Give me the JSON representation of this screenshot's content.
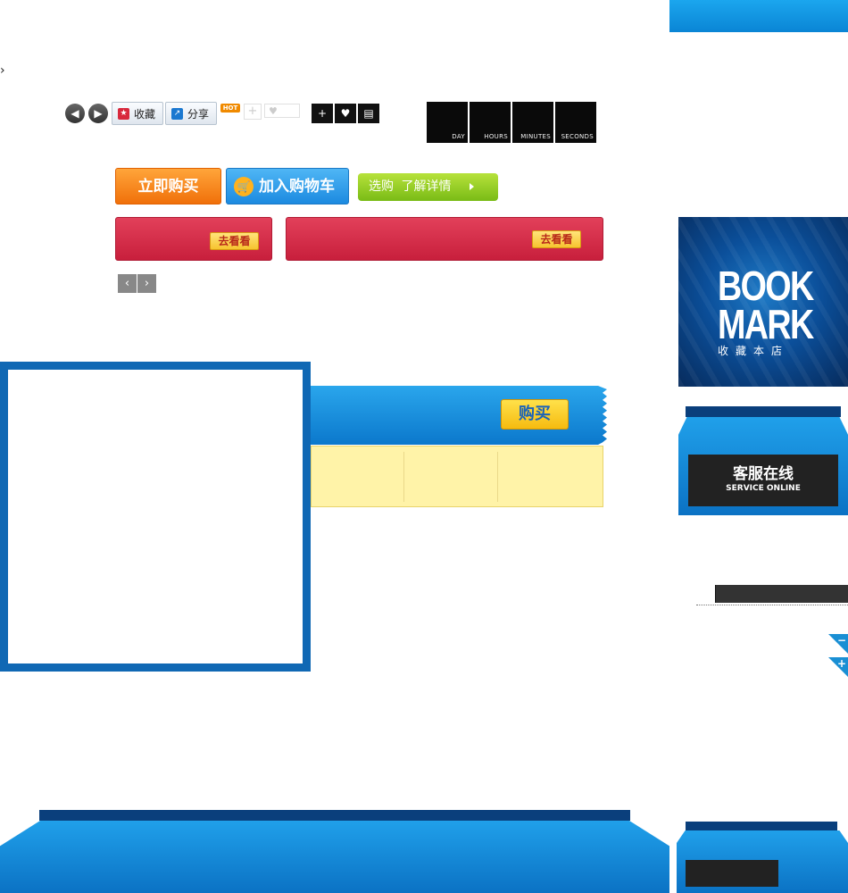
{
  "toolbar": {
    "favorite_label": "收藏",
    "share_label": "分享",
    "hot_badge": "HOT",
    "plus_symbol": "+",
    "heart_symbol": "♥",
    "comment_symbol": "▤"
  },
  "countdown": {
    "units": [
      "DAY",
      "HOURS",
      "MINUTES",
      "SECONDS"
    ]
  },
  "buttons": {
    "buy_now": "立即购买",
    "add_to_cart": "加入购物车",
    "select_buy": "选购",
    "learn_details": "了解详情",
    "go_look": "去看看"
  },
  "bookmark": {
    "line1": "BOOK",
    "line2": "MARK",
    "subtitle": "收藏本店"
  },
  "service": {
    "title_cn": "客服在线",
    "title_en": "SERVICE ONLINE"
  },
  "promo": {
    "buy_label": "购买"
  },
  "corner": {
    "minus": "−",
    "plus": "+"
  },
  "colors": {
    "accent_blue": "#0b78cc",
    "promo_red": "#c81f3c",
    "buy_orange": "#f0700a",
    "detail_green": "#79bb16",
    "highlight_yellow": "#fff3a8"
  },
  "icons": [
    "chevron-right-icon",
    "arrow-left-icon",
    "arrow-right-icon",
    "star-icon",
    "share-icon",
    "plus-icon",
    "heart-icon",
    "comment-icon",
    "cart-icon",
    "triangle-right-icon"
  ]
}
